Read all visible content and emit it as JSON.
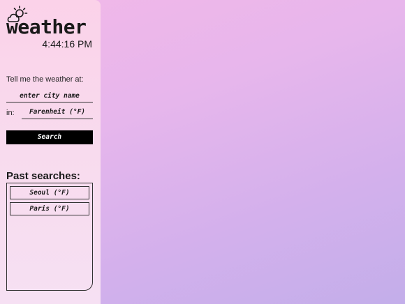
{
  "app": {
    "title": "weather",
    "clock": "4:44:16 PM"
  },
  "form": {
    "prompt_label": "Tell me the weather at:",
    "city_placeholder": "enter city name",
    "in_label": "in:",
    "unit_selected": "Farenheit (°F)",
    "search_label": "Search"
  },
  "past_searches": {
    "title": "Past searches:",
    "items": [
      {
        "label": "Seoul (°F)"
      },
      {
        "label": "Paris (°F)"
      }
    ]
  },
  "icons": {
    "logo": "partly-cloudy-icon"
  },
  "colors": {
    "accent": "#000000",
    "sidebar_bg": "#f8dbee",
    "main_bg_start": "#f2b8e8",
    "main_bg_end": "#c3aeea"
  }
}
